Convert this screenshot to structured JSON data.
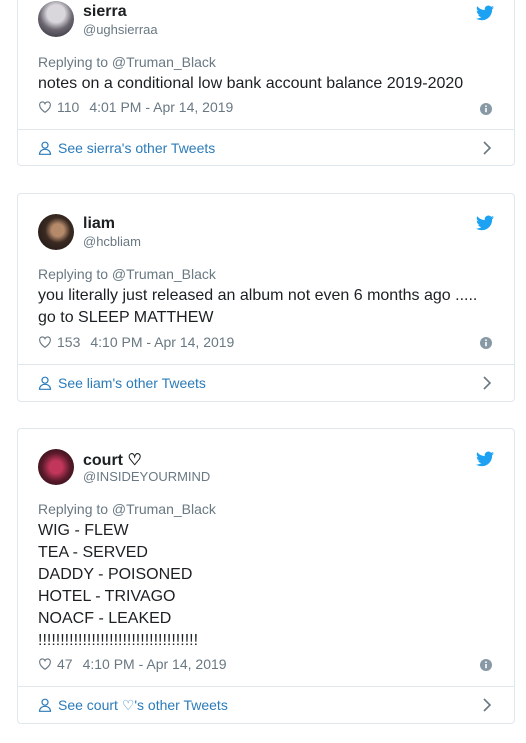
{
  "tweets": [
    {
      "name": "sierra",
      "handle": "@ughsierraa",
      "replying": "Replying to @Truman_Black",
      "text": "notes on a conditional low bank account balance 2019-2020",
      "likes": "110",
      "time": "4:01 PM - Apr 14, 2019",
      "footer": "See sierra's other Tweets",
      "icons": {
        "like": "heart-icon",
        "info": "info-icon",
        "bird": "twitter-bird-icon",
        "person": "person-icon",
        "chevron": "chevron-right-icon"
      }
    },
    {
      "name": "liam",
      "handle": "@hcbliam",
      "replying": "Replying to @Truman_Black",
      "text": "you literally just released an album not even 6 months ago .....\ngo to SLEEP MATTHEW",
      "likes": "153",
      "time": "4:10 PM - Apr 14, 2019",
      "footer": "See liam's other Tweets"
    },
    {
      "name": "court ♡",
      "handle": "@INSIDEYOURMIND",
      "replying": "Replying to @Truman_Black",
      "text": "WIG - FLEW\nTEA - SERVED\nDADDY - POISONED\nHOTEL - TRIVAGO\nNOACF - LEAKED\n!!!!!!!!!!!!!!!!!!!!!!!!!!!!!!!!!!!!",
      "likes": "47",
      "time": "4:10 PM - Apr 14, 2019",
      "footer": "See court ♡'s other Tweets"
    }
  ],
  "colors": {
    "link": "#2b7bb9",
    "twitter": "#1da1f2",
    "muted": "#697882",
    "border": "#e1e8ed"
  }
}
